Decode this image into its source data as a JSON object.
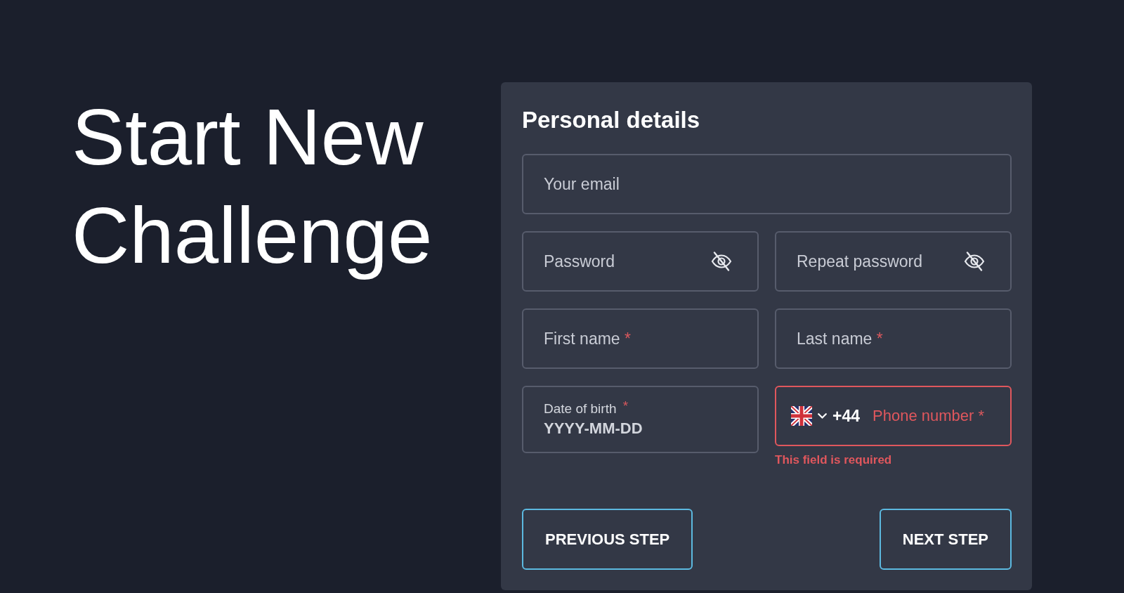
{
  "hero": {
    "title": "Start New Challenge"
  },
  "form": {
    "title": "Personal details",
    "rows": [
      {
        "fields": [
          {
            "kind": "text",
            "label": "Your email",
            "invalid": false
          }
        ]
      },
      {
        "fields": [
          {
            "kind": "password",
            "label": "Password",
            "revealed": false,
            "invalid": false
          },
          {
            "kind": "password",
            "label": "Repeat password",
            "revealed": false,
            "invalid": false
          }
        ]
      },
      {
        "fields": [
          {
            "kind": "text",
            "label": "First name",
            "required_mark": "*",
            "invalid": false
          },
          {
            "kind": "text",
            "label": "Last name",
            "required_mark": "*",
            "invalid": false
          }
        ]
      },
      {
        "fields": [
          {
            "kind": "date",
            "label": "Date of birth",
            "required_mark": "*",
            "placeholder": "YYYY-MM-DD",
            "invalid": false
          },
          {
            "kind": "phone",
            "country_code": "+44",
            "label": "Phone number",
            "required_mark": "*",
            "invalid": true,
            "error": "This field is required"
          }
        ]
      }
    ],
    "buttons": [
      {
        "label": "PREVIOUS STEP"
      },
      {
        "label": "NEXT STEP"
      }
    ]
  }
}
